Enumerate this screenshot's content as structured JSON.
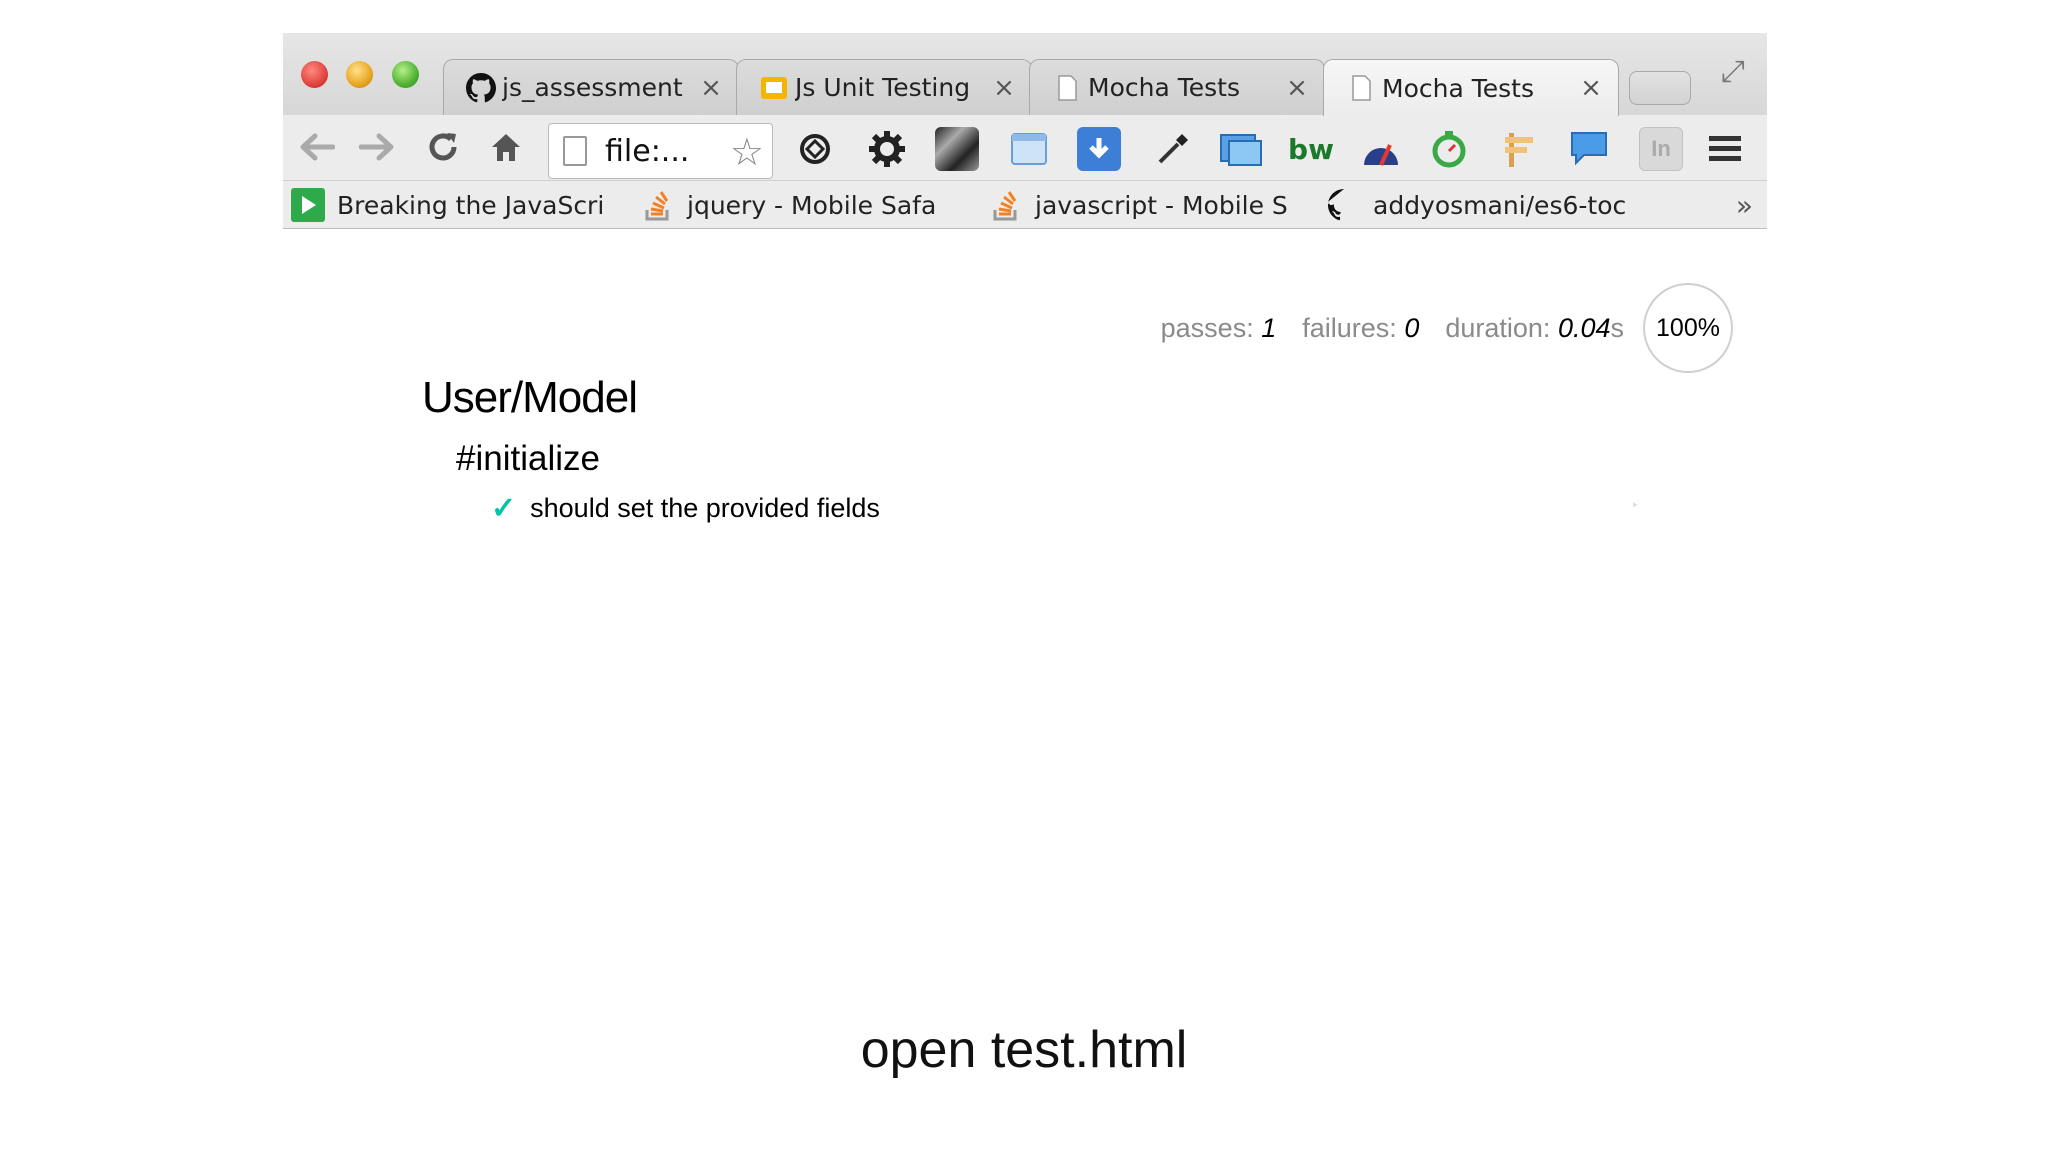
{
  "tabs": [
    {
      "title": "js_assessment",
      "icon": "github-icon",
      "close": "×"
    },
    {
      "title": "Js Unit Testing",
      "icon": "slides-icon",
      "close": "×"
    },
    {
      "title": "Mocha Tests",
      "icon": "document-icon",
      "close": "×"
    },
    {
      "title": "Mocha Tests",
      "icon": "document-icon",
      "close": "×",
      "active": true
    }
  ],
  "omnibox": {
    "text": "file:..."
  },
  "bookmarks": [
    {
      "label": "Breaking the JavaScri",
      "icon": "play-icon"
    },
    {
      "label": "jquery - Mobile Safa",
      "icon": "stackoverflow-icon"
    },
    {
      "label": "javascript - Mobile S",
      "icon": "stackoverflow-icon"
    },
    {
      "label": "addyosmani/es6-toc",
      "icon": "github-icon"
    }
  ],
  "bookmarks_more": "»",
  "extensions": {
    "bw_label": "bw",
    "in_label": "In"
  },
  "stats": {
    "passes_label": "passes:",
    "passes": "1",
    "failures_label": "failures:",
    "failures": "0",
    "duration_label": "duration:",
    "duration": "0.04",
    "duration_unit": "s",
    "progress": "100%"
  },
  "suite": {
    "title": "User/Model",
    "subsuite": "#initialize",
    "test": {
      "check": "✓",
      "title": "should set the provided fields",
      "replay": "‣"
    }
  },
  "caption": "open test.html",
  "colors": {
    "pass_check": "#00c6a8",
    "slides": "#f4b400",
    "bookmark_play": "#2eaa4a"
  }
}
